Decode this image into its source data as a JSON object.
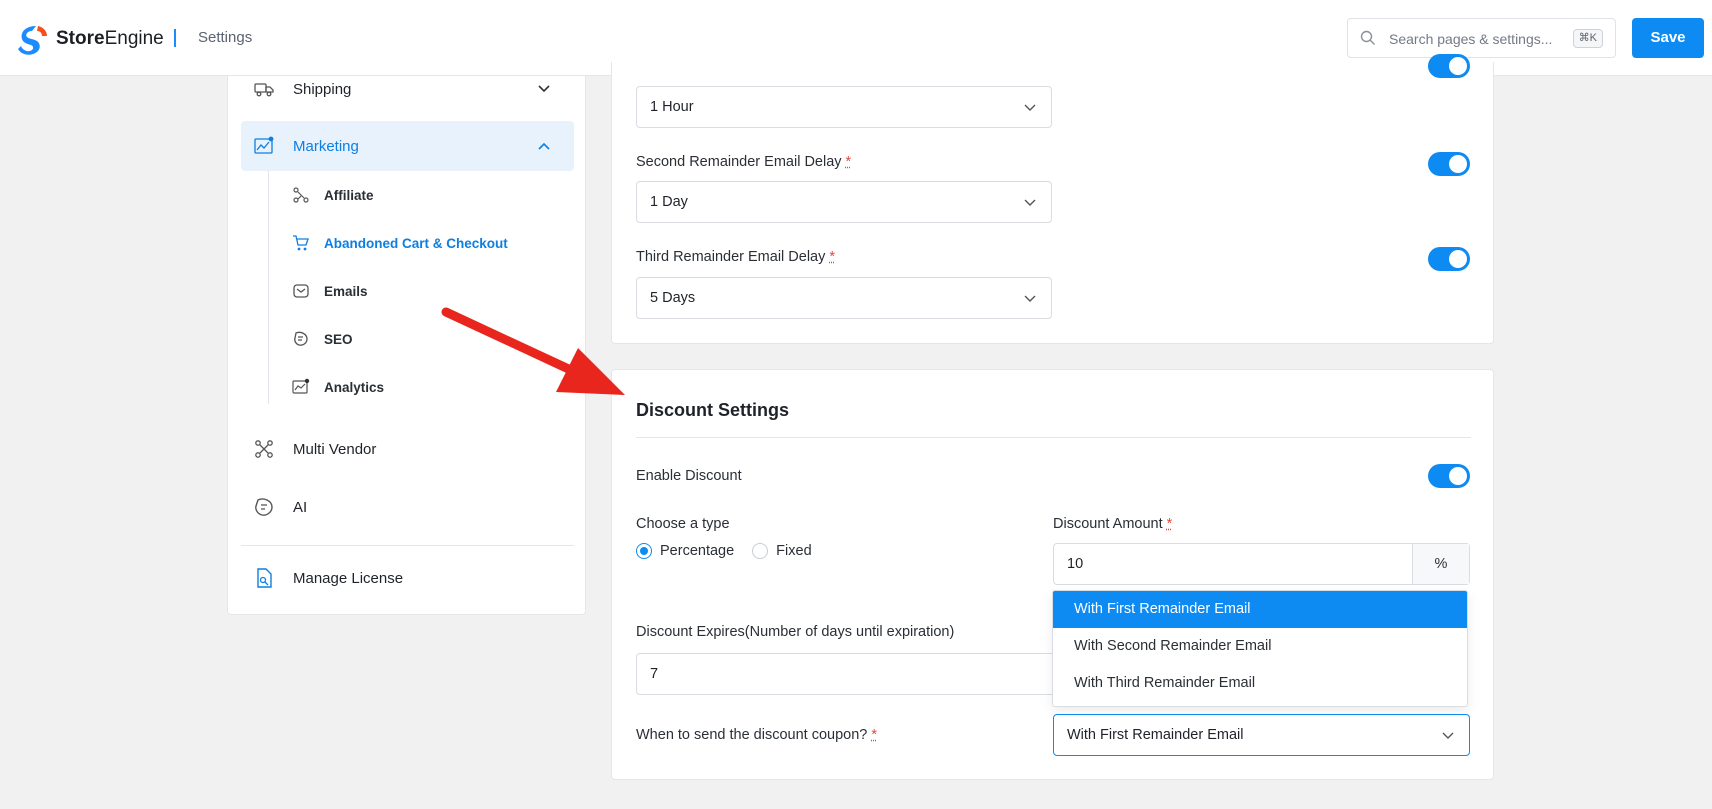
{
  "header": {
    "brand_bold": "Store",
    "brand_rest": "Engine",
    "title": "Settings",
    "search_placeholder": "Search pages & settings...",
    "search_shortcut": "⌘K",
    "save_label": "Save"
  },
  "sidebar": {
    "items": [
      {
        "label": "Shipping",
        "icon": "truck-icon"
      },
      {
        "label": "Marketing",
        "icon": "chart-icon"
      },
      {
        "label": "Multi Vendor",
        "icon": "network-icon"
      },
      {
        "label": "AI",
        "icon": "ai-icon"
      },
      {
        "label": "Manage License",
        "icon": "license-icon"
      }
    ],
    "marketing_sub": [
      {
        "label": "Affiliate",
        "icon": "affiliate-icon"
      },
      {
        "label": "Abandoned Cart & Checkout",
        "icon": "cart-icon"
      },
      {
        "label": "Emails",
        "icon": "mail-icon"
      },
      {
        "label": "SEO",
        "icon": "seo-icon"
      },
      {
        "label": "Analytics",
        "icon": "analytics-icon"
      }
    ]
  },
  "reminders": {
    "first_value": "1 Hour",
    "second_label": "Second Remainder Email Delay",
    "second_value": "1 Day",
    "third_label": "Third Remainder Email Delay",
    "third_value": "5 Days",
    "required_mark": "*"
  },
  "discount": {
    "title": "Discount Settings",
    "enable_label": "Enable Discount",
    "type_label": "Choose a type",
    "type_options": [
      "Percentage",
      "Fixed"
    ],
    "type_selected": "Percentage",
    "amount_label": "Discount Amount",
    "amount_value": "10",
    "amount_unit": "%",
    "expires_label": "Discount Expires(Number of days until expiration)",
    "expires_value": "7",
    "when_label": "When to send the discount coupon?",
    "when_value": "With First Remainder Email",
    "when_options": [
      "With First Remainder Email",
      "With Second Remainder Email",
      "With Third Remainder Email"
    ]
  },
  "colors": {
    "accent": "#0d8bf2",
    "annotation_arrow": "#e8261e"
  }
}
